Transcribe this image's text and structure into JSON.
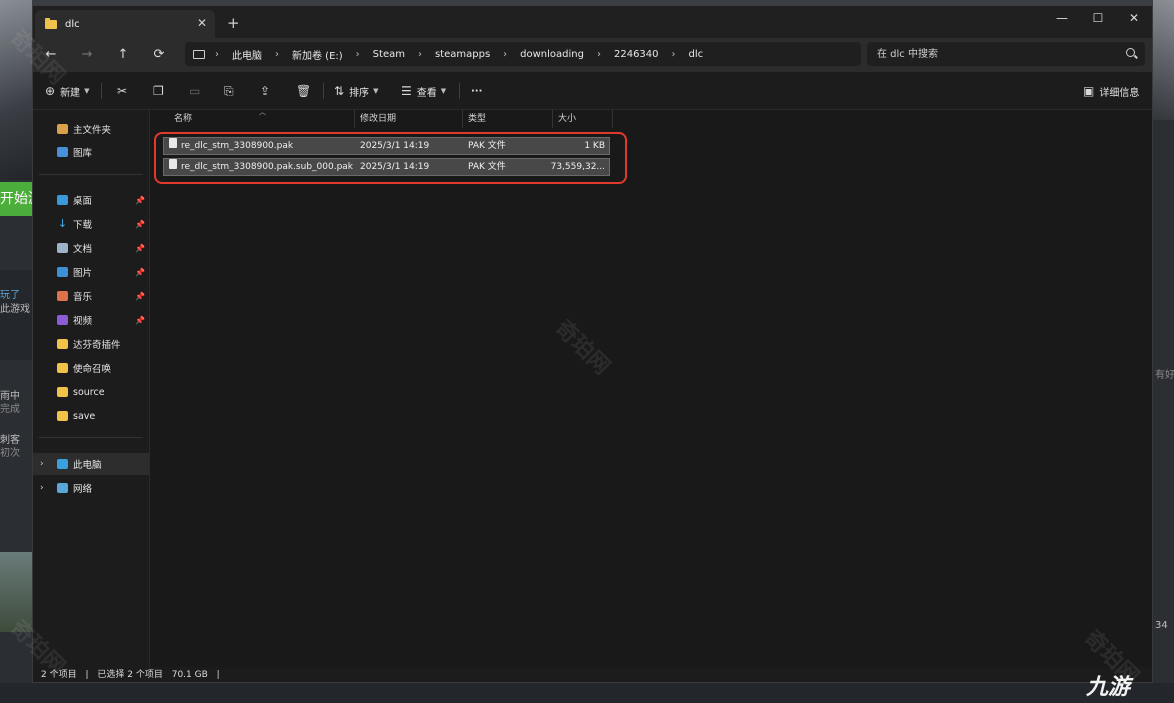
{
  "window": {
    "tab_title": "dlc",
    "tab_close": "✕",
    "new_tab": "+",
    "minimize": "—",
    "maximize": "☐",
    "close": "✕"
  },
  "nav": {
    "back": "←",
    "forward": "→",
    "up": "↑",
    "refresh": "⟳",
    "breadcrumb": [
      "此电脑",
      "新加卷 (E:)",
      "Steam",
      "steamapps",
      "downloading",
      "2246340",
      "dlc"
    ],
    "search_placeholder": "在 dlc 中搜索"
  },
  "toolbar": {
    "new_label": "新建",
    "sort_label": "排序",
    "view_label": "查看",
    "more_label": "···",
    "details_label": "详细信息"
  },
  "sidebar": {
    "quick": [
      {
        "label": "主文件夹",
        "icon": "home-icon"
      },
      {
        "label": "图库",
        "icon": "gallery-icon"
      }
    ],
    "pinned": [
      {
        "label": "桌面",
        "icon": "desktop-icon"
      },
      {
        "label": "下载",
        "icon": "download-icon"
      },
      {
        "label": "文档",
        "icon": "document-icon"
      },
      {
        "label": "图片",
        "icon": "pictures-icon"
      },
      {
        "label": "音乐",
        "icon": "music-icon"
      },
      {
        "label": "视频",
        "icon": "video-icon"
      }
    ],
    "folders": [
      {
        "label": "达芬奇插件",
        "icon": "folder-icon"
      },
      {
        "label": "使命召唤",
        "icon": "folder-icon"
      },
      {
        "label": "source",
        "icon": "folder-icon"
      },
      {
        "label": "save",
        "icon": "folder-icon"
      }
    ],
    "this_pc": "此电脑",
    "network": "网络"
  },
  "columns": {
    "name": "名称",
    "date": "修改日期",
    "type": "类型",
    "size": "大小"
  },
  "files": [
    {
      "name": "re_dlc_stm_3308900.pak",
      "date": "2025/3/1 14:19",
      "type": "PAK 文件",
      "size": "1 KB"
    },
    {
      "name": "re_dlc_stm_3308900.pak.sub_000.pak",
      "date": "2025/3/1 14:19",
      "type": "PAK 文件",
      "size": "73,559,32..."
    }
  ],
  "status": {
    "count": "2 个项目",
    "selected": "已选择 2 个项目",
    "size": "70.1 GB"
  },
  "background": {
    "start_button": "开始游",
    "watermark": "奇珀网",
    "logo": "九游",
    "text_1": "玩了",
    "text_2": "此游戏",
    "text_3": "雨中",
    "text_4": "完成",
    "text_5": "刺客",
    "text_6": "初次",
    "text_7": "有好",
    "text_8": "34"
  },
  "colors": {
    "selection_border": "#e23a2a",
    "folder": "#f0c14b",
    "row_selected": "#484848"
  }
}
